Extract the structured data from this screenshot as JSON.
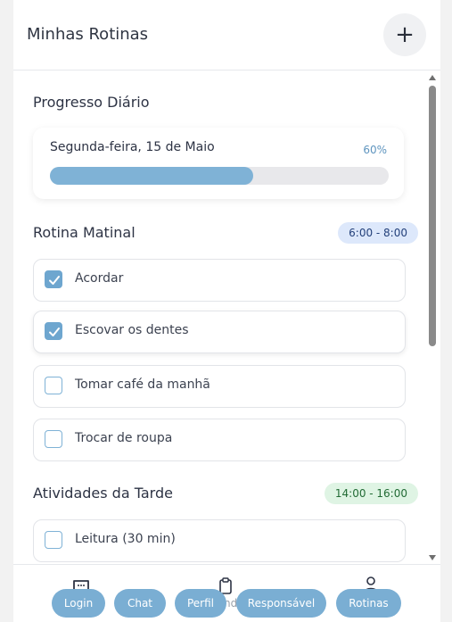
{
  "header": {
    "title": "Minhas Rotinas",
    "add_label": "+"
  },
  "progress": {
    "title": "Progresso Diário",
    "date": "Segunda-feira, 15 de Maio",
    "percent_label": "60%",
    "fraction": 0.6
  },
  "morning": {
    "title": "Rotina Matinal",
    "time": "6:00 - 8:00",
    "tasks": [
      {
        "label": "Acordar",
        "checked": true
      },
      {
        "label": "Escovar os dentes",
        "checked": true
      },
      {
        "label": "Tomar café da manhã",
        "checked": false
      },
      {
        "label": "Trocar de roupa",
        "checked": false
      }
    ]
  },
  "afternoon": {
    "title": "Atividades da Tarde",
    "time": "14:00 - 16:00",
    "tasks": [
      {
        "label": "Leitura (30 min)",
        "checked": false
      }
    ]
  },
  "nav": {
    "items": [
      "Login",
      "Chat",
      "Perfil",
      "Responsável",
      "Rotinas"
    ],
    "partial_text": "nd"
  },
  "colors": {
    "accent": "#7aaed3",
    "progress": "#7fb2d6"
  }
}
